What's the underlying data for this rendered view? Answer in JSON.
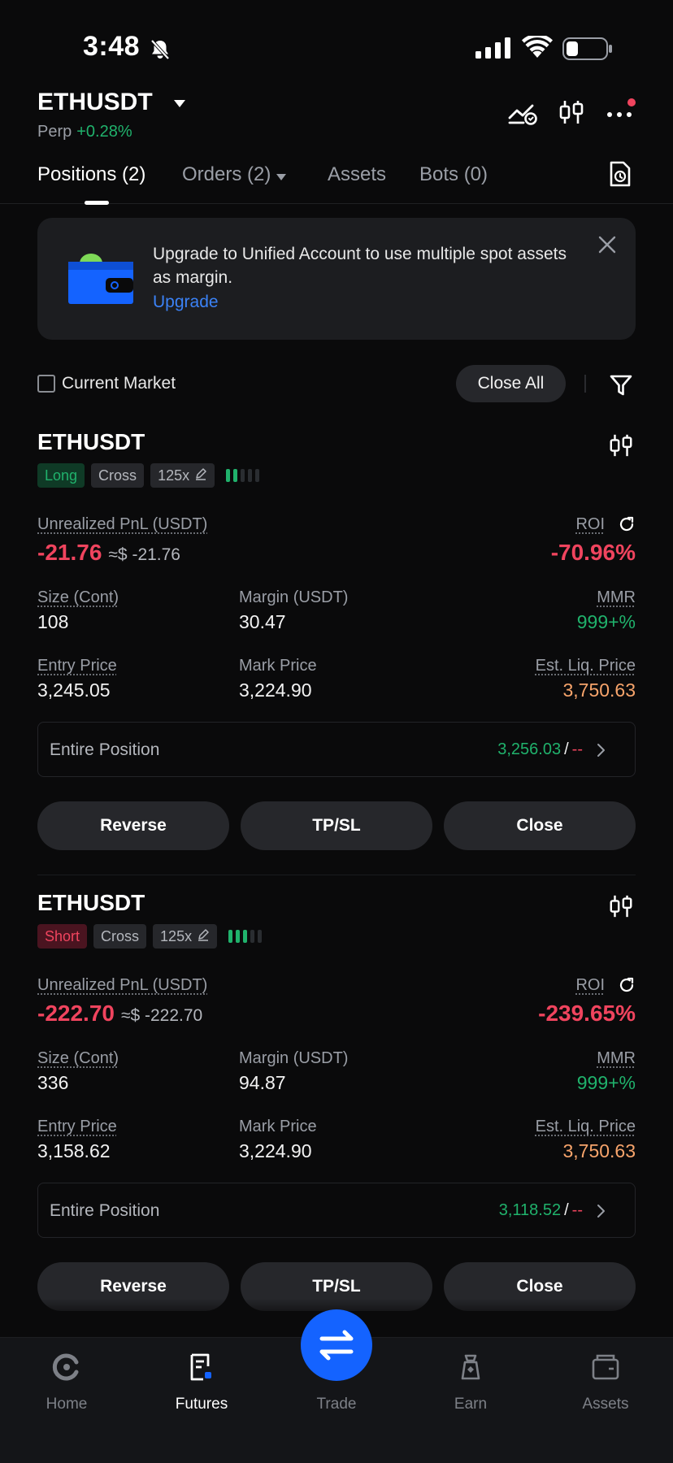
{
  "status_bar": {
    "time": "3:48"
  },
  "header": {
    "symbol": "ETHUSDT",
    "contract_type": "Perp",
    "change": "+0.28%"
  },
  "tabs": [
    {
      "label": "Positions (2)",
      "active": true
    },
    {
      "label": "Orders (2)"
    },
    {
      "label": "Assets"
    },
    {
      "label": "Bots (0)"
    }
  ],
  "banner": {
    "text": "Upgrade to Unified Account to use multiple spot assets as margin.",
    "link": "Upgrade"
  },
  "filter": {
    "current_market_label": "Current Market",
    "close_all_label": "Close All"
  },
  "labels": {
    "unrealized_pnl": "Unrealized PnL (USDT)",
    "roi": "ROI",
    "size": "Size (Cont)",
    "margin": "Margin (USDT)",
    "mmr": "MMR",
    "entry_price": "Entry Price",
    "mark_price": "Mark Price",
    "liq_price": "Est. Liq. Price",
    "entire_position": "Entire Position",
    "reverse": "Reverse",
    "tpsl": "TP/SL",
    "close": "Close"
  },
  "positions": [
    {
      "symbol": "ETHUSDT",
      "side": "Long",
      "margin_mode": "Cross",
      "leverage": "125x",
      "risk_level_bars_on": 2,
      "pnl": "-21.76",
      "pnl_usd": "≈$ -21.76",
      "roi": "-70.96%",
      "size": "108",
      "margin": "30.47",
      "mmr": "999+%",
      "entry_price": "3,245.05",
      "mark_price": "3,224.90",
      "liq_price": "3,750.63",
      "tp": "3,256.03",
      "sl": "--"
    },
    {
      "symbol": "ETHUSDT",
      "side": "Short",
      "margin_mode": "Cross",
      "leverage": "125x",
      "risk_level_bars_on": 3,
      "pnl": "-222.70",
      "pnl_usd": "≈$ -222.70",
      "roi": "-239.65%",
      "size": "336",
      "margin": "94.87",
      "mmr": "999+%",
      "entry_price": "3,158.62",
      "mark_price": "3,224.90",
      "liq_price": "3,750.63",
      "tp": "3,118.52",
      "sl": "--"
    }
  ],
  "nav": {
    "home": "Home",
    "futures": "Futures",
    "trade": "Trade",
    "earn": "Earn",
    "assets": "Assets"
  },
  "colors": {
    "green": "#20b26c",
    "red": "#f0445e",
    "orange": "#f7a46b",
    "accent_blue": "#1463ff",
    "link_blue": "#3b82f6"
  }
}
